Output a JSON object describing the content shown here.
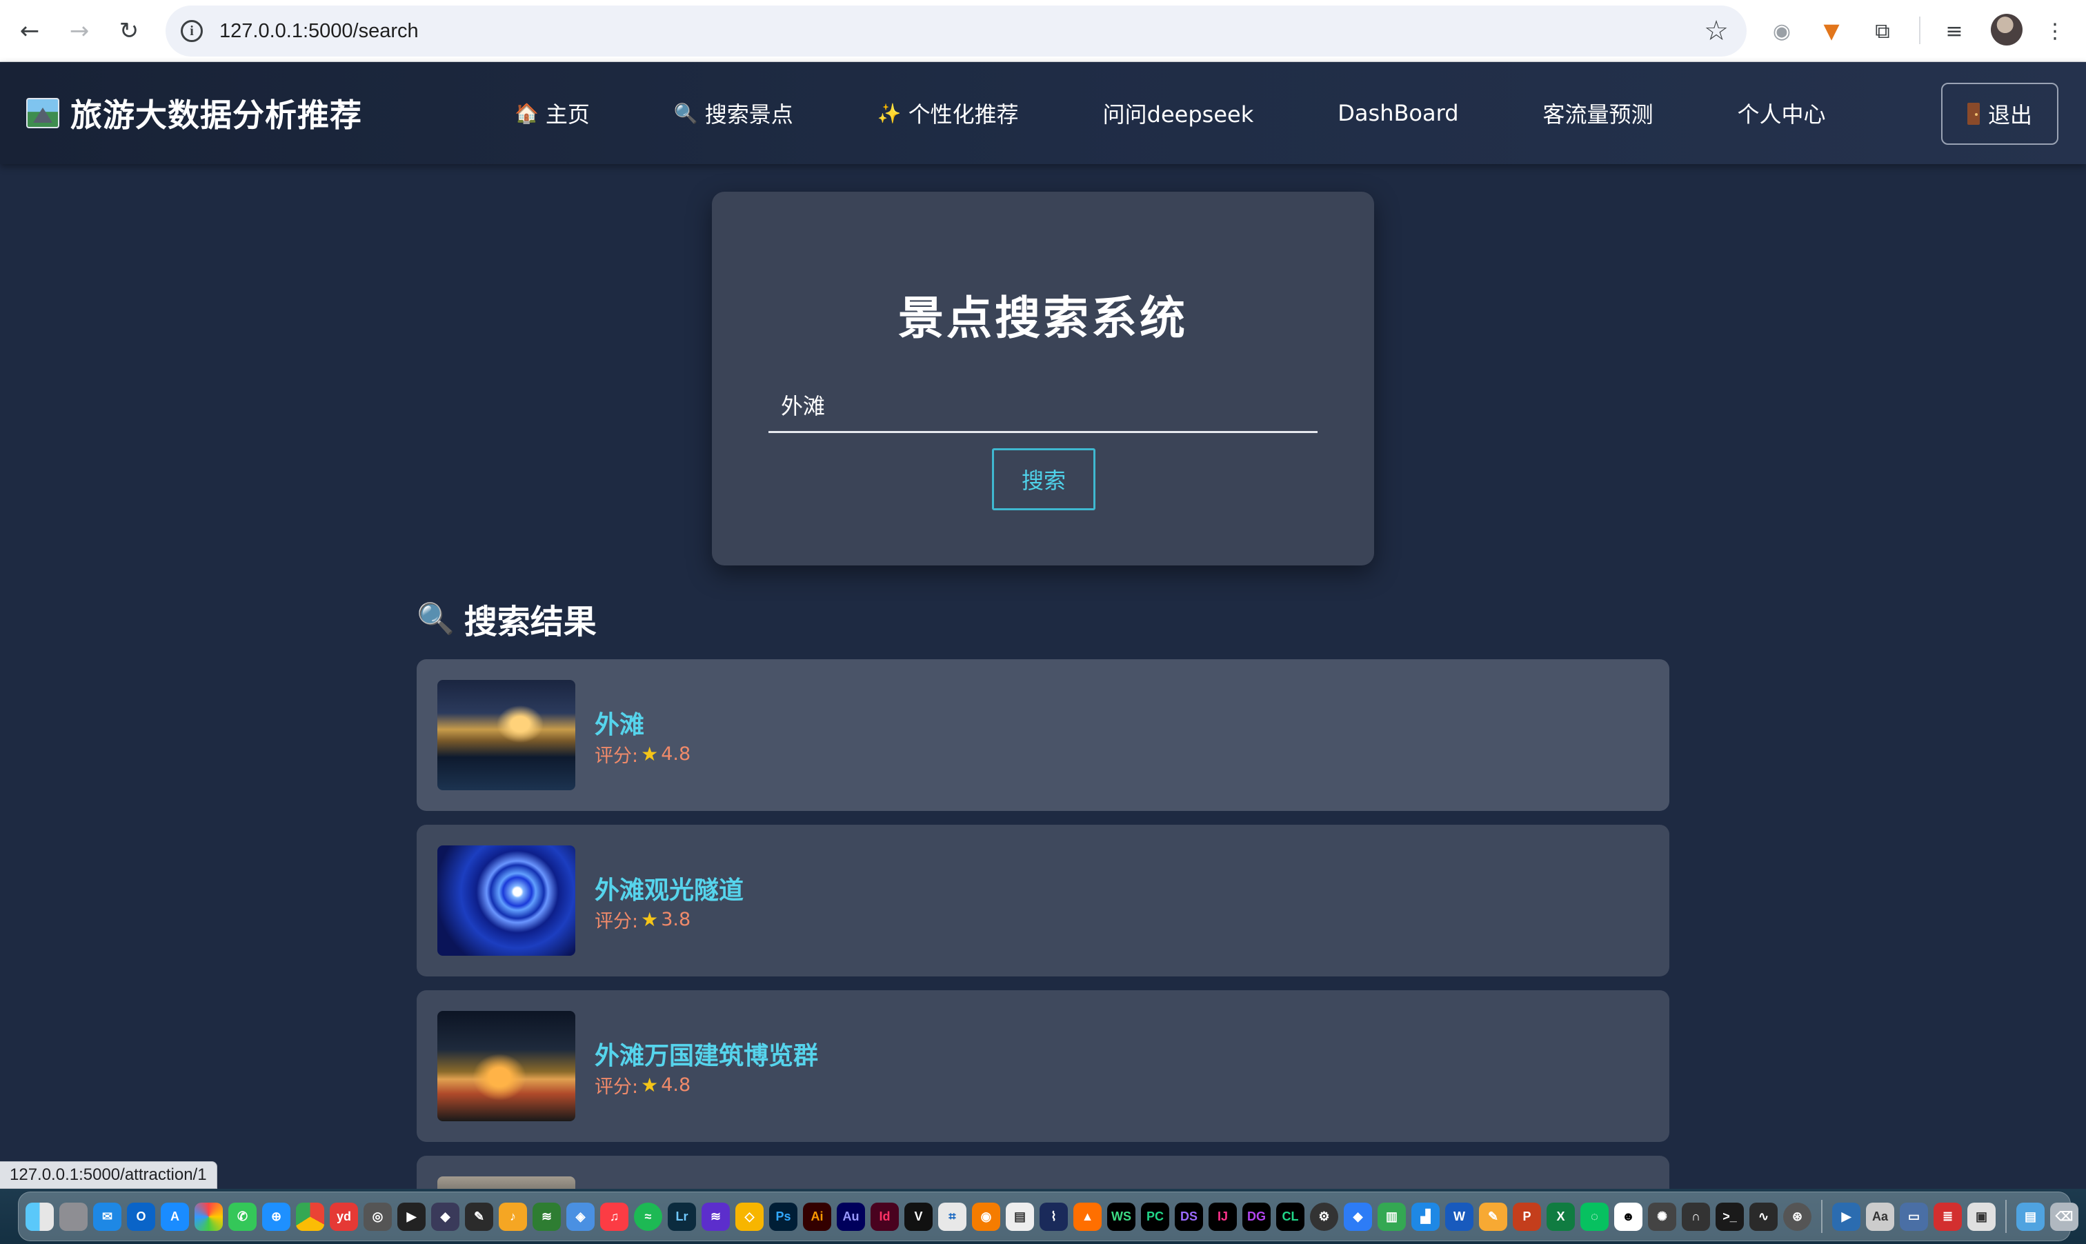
{
  "browser": {
    "url": "127.0.0.1:5000/search",
    "status_url": "127.0.0.1:5000/attraction/1"
  },
  "nav": {
    "brand": "旅游大数据分析推荐",
    "links": [
      {
        "icon": "house-icon",
        "glyph": "🏠",
        "label": "主页"
      },
      {
        "icon": "magnifier-icon",
        "glyph": "🔍",
        "label": "搜索景点"
      },
      {
        "icon": "sparkles-icon",
        "glyph": "✨",
        "label": "个性化推荐"
      },
      {
        "icon": "",
        "glyph": "",
        "label": "问问deepseek"
      },
      {
        "icon": "",
        "glyph": "",
        "label": "DashBoard"
      },
      {
        "icon": "",
        "glyph": "",
        "label": "客流量预测"
      },
      {
        "icon": "",
        "glyph": "",
        "label": "个人中心"
      }
    ],
    "logout": "退出"
  },
  "search": {
    "title": "景点搜索系统",
    "query": "外滩",
    "button": "搜索"
  },
  "results": {
    "heading": "搜索结果",
    "items": [
      {
        "name": "外滩",
        "score_label": "评分: ",
        "rating": "4.8"
      },
      {
        "name": "外滩观光隧道",
        "score_label": "评分: ",
        "rating": "3.8"
      },
      {
        "name": "外滩万国建筑博览群",
        "score_label": "评分: ",
        "rating": "4.8"
      }
    ]
  },
  "colors": {
    "accent": "#56d4ec",
    "score": "#f08a6a",
    "page_bg": "#1e2a42",
    "card_bg": "#3b4457"
  }
}
